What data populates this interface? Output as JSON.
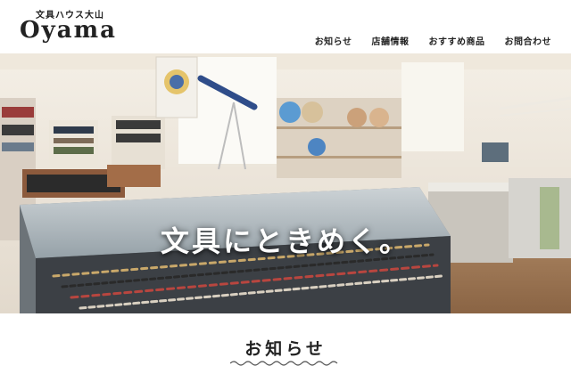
{
  "header": {
    "logo_sub": "文具ハウス大山",
    "logo_main": "Oyama"
  },
  "nav": {
    "items": [
      {
        "label": "お知らせ"
      },
      {
        "label": "店舗情報"
      },
      {
        "label": "おすすめ商品"
      },
      {
        "label": "お問合わせ"
      }
    ]
  },
  "hero": {
    "tagline": "文具にときめく。"
  },
  "section": {
    "title": "お知らせ"
  },
  "colors": {
    "text": "#222222",
    "background": "#ffffff",
    "accent_wave": "#555555"
  }
}
